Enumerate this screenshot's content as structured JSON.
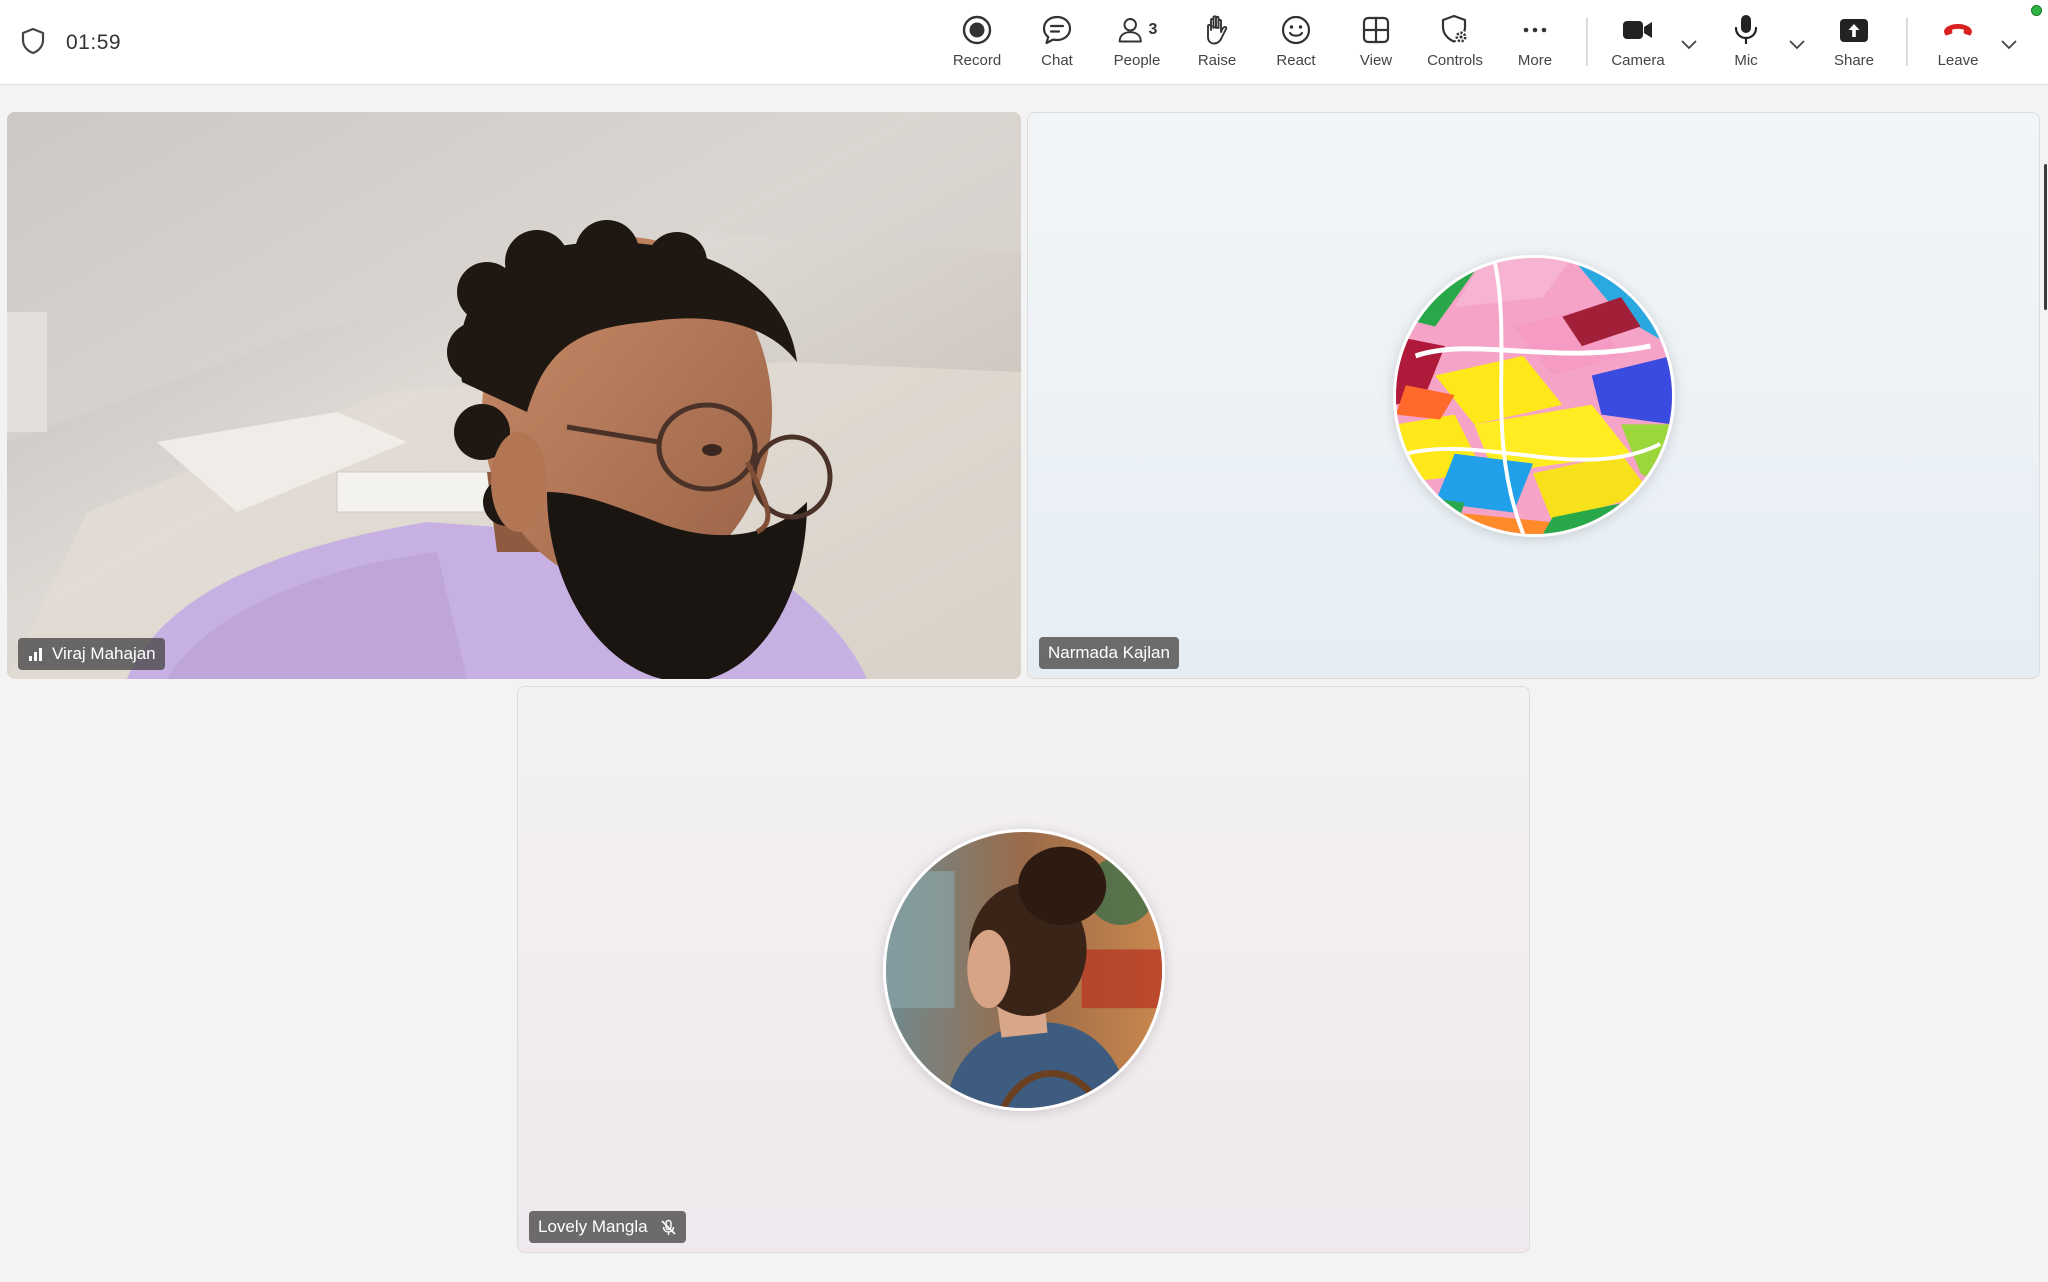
{
  "meeting": {
    "timer": "01:59",
    "participant_count": "3"
  },
  "toolbar": {
    "record_label": "Record",
    "chat_label": "Chat",
    "people_label": "People",
    "raise_label": "Raise",
    "react_label": "React",
    "view_label": "View",
    "controls_label": "Controls",
    "more_label": "More",
    "camera_label": "Camera",
    "mic_label": "Mic",
    "share_label": "Share",
    "leave_label": "Leave"
  },
  "participants": [
    {
      "name": "Viraj Mahajan",
      "indicator": "signal-strength-icon",
      "video": "on"
    },
    {
      "name": "Narmada Kajlan",
      "indicator": "",
      "video": "off"
    },
    {
      "name": "Lovely Mangla",
      "indicator": "mic-muted-icon",
      "video": "off"
    }
  ],
  "colors": {
    "leave_red": "#d92121",
    "status_green": "#2fb344",
    "nametag_bg": "#464646"
  }
}
